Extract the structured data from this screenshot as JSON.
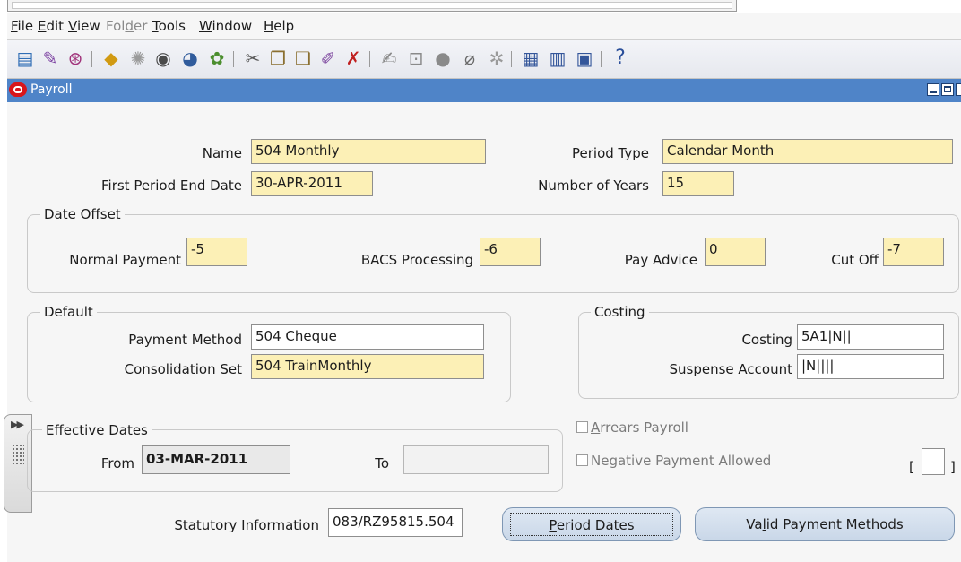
{
  "menu": {
    "items": [
      {
        "prefix": "",
        "key": "F",
        "rest": "ile",
        "enabled": true
      },
      {
        "prefix": "",
        "key": "E",
        "rest": "dit",
        "enabled": true
      },
      {
        "prefix": "",
        "key": "V",
        "rest": "iew",
        "enabled": true
      },
      {
        "prefix": "Fol",
        "key": "d",
        "rest": "er",
        "enabled": false
      },
      {
        "prefix": "",
        "key": "T",
        "rest": "ools",
        "enabled": true
      },
      {
        "prefix": "",
        "key": "W",
        "rest": "indow",
        "enabled": true
      },
      {
        "prefix": "",
        "key": "H",
        "rest": "elp",
        "enabled": true
      }
    ]
  },
  "toolbar": {
    "icons": [
      "new-record-icon",
      "find-icon",
      "navigator-icon",
      "save-icon",
      "next-step-icon",
      "print-icon",
      "close-form-icon",
      "switch-responsibility-icon",
      "cut-icon",
      "copy-icon",
      "paste-icon",
      "clear-record-icon",
      "delete-record-icon",
      "edit-field-icon",
      "zoom-icon",
      "translations-icon",
      "attachments-icon",
      "folder-tools-icon",
      "calendar-icon",
      "calendar-alt-icon",
      "summary-icon",
      "help-icon"
    ]
  },
  "window": {
    "title": "Payroll"
  },
  "form": {
    "name": {
      "label": "Name",
      "value": "504 Monthly"
    },
    "period_type": {
      "label": "Period Type",
      "value": "Calendar Month"
    },
    "first_period_end_date": {
      "label": "First Period End Date",
      "value": "30-APR-2011"
    },
    "number_of_years": {
      "label": "Number of Years",
      "value": "15"
    },
    "date_offset": {
      "title": "Date Offset",
      "normal_payment": {
        "label": "Normal Payment",
        "value": "-5"
      },
      "bacs_processing": {
        "label": "BACS Processing",
        "value": "-6"
      },
      "pay_advice": {
        "label": "Pay Advice",
        "value": "0"
      },
      "cut_off": {
        "label": "Cut Off",
        "value": "-7"
      }
    },
    "default": {
      "title": "Default",
      "payment_method": {
        "label": "Payment Method",
        "value": "504 Cheque"
      },
      "consolidation_set": {
        "label": "Consolidation Set",
        "value": "504 TrainMonthly"
      }
    },
    "costing_group": {
      "title": "Costing",
      "costing": {
        "label": "Costing",
        "value": "5A1|N||"
      },
      "suspense_account": {
        "label": "Suspense Account",
        "value": "|N||||"
      }
    },
    "effective_dates": {
      "title": "Effective Dates",
      "from": {
        "label": "From",
        "value": "03-MAR-2011"
      },
      "to": {
        "label": "To",
        "value": ""
      }
    },
    "arrears_payroll": {
      "label_key": "A",
      "label_rest": "rrears Payroll",
      "checked": false
    },
    "negative_payment_allowed": {
      "label": "Negative Payment Allowed",
      "checked": false
    },
    "dff_open": "[",
    "dff_close": "]",
    "statutory_information": {
      "label": "Statutory Information",
      "value": "083/RZ95815.504"
    }
  },
  "buttons": {
    "period_dates": {
      "key": "P",
      "rest": "eriod Dates"
    },
    "valid_payment_methods": {
      "prefix": "Va",
      "key": "l",
      "rest": "id Payment Methods"
    }
  }
}
